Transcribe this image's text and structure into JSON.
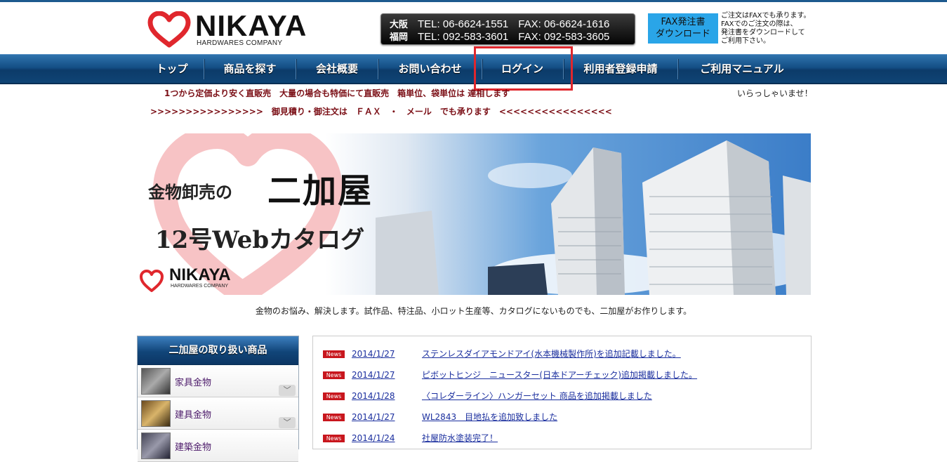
{
  "header": {
    "logo_word": "NIKAYA",
    "logo_sub": "HARDWARES COMPANY",
    "tel_rows": [
      {
        "city": "大阪",
        "tel": "TEL: 06-6624-1551",
        "fax": "FAX: 06-6624-1616"
      },
      {
        "city": "福岡",
        "tel": "TEL: 092-583-3601",
        "fax": "FAX: 092-583-3605"
      }
    ],
    "fax_button": {
      "line1": "FAX発注書",
      "line2": "ダウンロード"
    },
    "fax_note": [
      "ご注文はFAXでも承ります。",
      "FAXでのご注文の際は、",
      "発注書をダウンロードして",
      "ご利用下さい。"
    ]
  },
  "nav": {
    "items": [
      {
        "label": "トップ"
      },
      {
        "label": "商品を探す"
      },
      {
        "label": "会社概要"
      },
      {
        "label": "お問い合わせ"
      },
      {
        "label": "ログイン"
      },
      {
        "label": "利用者登録申請"
      },
      {
        "label": "ご利用マニュアル"
      }
    ]
  },
  "tagline": {
    "line1": "1つから定価より安く直販売　大量の場合も特価にて直販売　箱単位、袋単位は 達相します",
    "welcome": "いらっしゃいませ！",
    "line2": ">>>>>>>>>>>>>>>>　御見積り・御注文は　ＦＡＸ　・　メール　でも承ります　<<<<<<<<<<<<<<<<"
  },
  "banner": {
    "title1": "金物卸売の",
    "title2": "二加屋",
    "title3": "12号Webカタログ",
    "logo_word": "NIKAYA",
    "logo_sub": "HARDWARES COMPANY"
  },
  "caption": "金物のお悩み、解決します。試作品、特注品、小ロット生産等、カタログにないものでも、二加屋がお作りします。",
  "sidebar": {
    "title": "二加屋の取り扱い商品",
    "items": [
      {
        "label": "家具金物"
      },
      {
        "label": "建具金物"
      },
      {
        "label": "建築金物"
      }
    ]
  },
  "news": {
    "badge": "News",
    "items": [
      {
        "date": "2014/1/27",
        "text": "ステンレスダイアモンドアイ(水本機械製作所)を追加記載しました。"
      },
      {
        "date": "2014/1/27",
        "text": "ピボットヒンジ　ニュースター(日本ドアーチェック)追加掲載しました。"
      },
      {
        "date": "2014/1/28",
        "text": "〈コレダーライン〉ハンガーセット 商品を追加掲載しました"
      },
      {
        "date": "2014/1/27",
        "text": "WL2843　目地払を追加致しました"
      },
      {
        "date": "2014/1/24",
        "text": "社屋防水塗装完了！"
      }
    ]
  },
  "colors": {
    "accent": "#1d5a8e",
    "brand_red": "#e0272d",
    "tagline": "#7b0f16",
    "link": "#1a2e9e"
  }
}
